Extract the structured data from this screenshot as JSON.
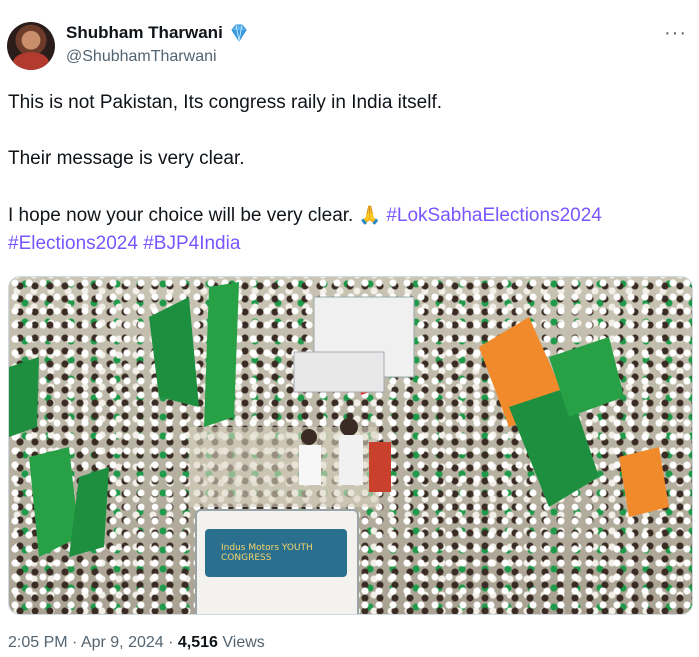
{
  "user": {
    "name": "Shubham Tharwani",
    "handle": "@ShubhamTharwani"
  },
  "more_label": "···",
  "tweet": {
    "line1": "This is not Pakistan, Its congress raily in India itself.",
    "line2": "Their message is very clear.",
    "line3": "I hope now your choice will be very clear.",
    "emoji": "🙏",
    "hashtags": [
      "#LokSabhaElections2024",
      "#Elections2024",
      "#BJP4India"
    ]
  },
  "media": {
    "van_banner": "Indus Motors  YOUTH CONGRESS",
    "flag_text": "YOUTH CONGRESS"
  },
  "meta": {
    "time": "2:05 PM",
    "sep1": " · ",
    "date": "Apr 9, 2024",
    "sep2": " · ",
    "views_count": "4,516",
    "views_label": " Views"
  },
  "colors": {
    "hashtag": "#7856ff",
    "secondary_text": "#536471",
    "badge": "#4aa8e8"
  }
}
